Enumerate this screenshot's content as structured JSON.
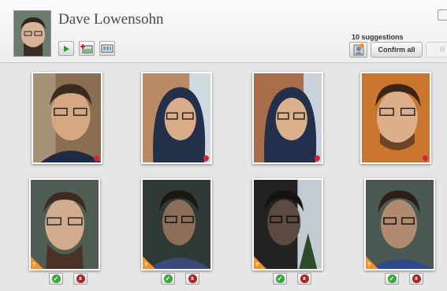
{
  "person": {
    "name": "Dave Lowensohn"
  },
  "toolbar": {
    "play_icon": "play-icon",
    "add_to_album_icon": "add-photos-icon",
    "slideshow_icon": "photo-strip-icon"
  },
  "suggestions": {
    "count_label": "10 suggestions",
    "confirm_label": "Confirm all",
    "reject_label": "R"
  },
  "colors": {
    "confirm_green": "#3aa43f",
    "reject_red": "#a32a2a",
    "flag_orange": "#f0922d",
    "location_pin": "#d9233c"
  },
  "confirmed_photos": [
    {
      "icon": "location-pin-icon"
    },
    {
      "icon": "location-pin-icon"
    },
    {
      "icon": "location-pin-icon"
    },
    {
      "icon": "location-pin-icon"
    }
  ],
  "suggested_photos": [
    {
      "icon": "suggestion-flag-icon",
      "flag_text": "?"
    },
    {
      "icon": "suggestion-flag-icon",
      "flag_text": "?"
    },
    {
      "icon": "suggestion-flag-icon",
      "flag_text": "?"
    },
    {
      "icon": "suggestion-flag-icon",
      "flag_text": "?"
    }
  ],
  "actions": {
    "confirm_glyph": "✓",
    "reject_glyph": "x"
  }
}
